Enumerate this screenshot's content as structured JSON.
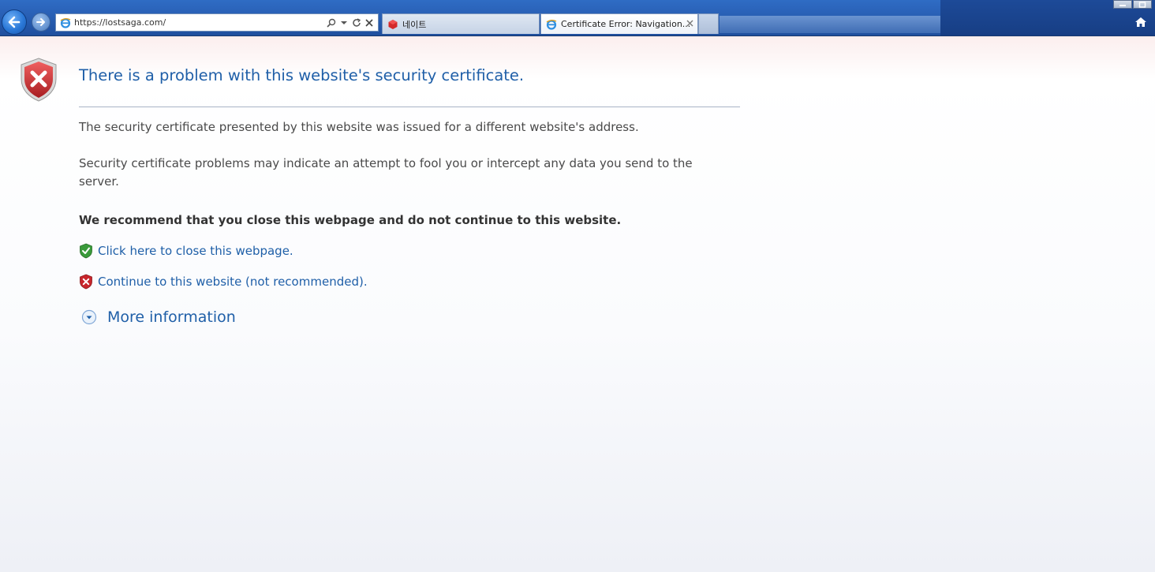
{
  "browser": {
    "address_url": "https://lostsaga.com/",
    "tabs": [
      {
        "label": "네이트",
        "active": false
      },
      {
        "label": "Certificate Error: Navigation...",
        "active": true
      }
    ]
  },
  "error_page": {
    "title": "There is a problem with this website's security certificate.",
    "paragraph1": "The security certificate presented by this website was issued for a different website's address.",
    "paragraph2": "Security certificate problems may indicate an attempt to fool you or intercept any data you send to the server.",
    "recommendation": "We recommend that you close this webpage and do not continue to this website.",
    "close_link": "Click here to close this webpage.",
    "continue_link": "Continue to this website (not recommended).",
    "more_info": "More information"
  },
  "colors": {
    "link": "#1f5fa8",
    "chrome": "#2a62b8",
    "error_shield": "#c8262c",
    "safe_shield": "#3a9a3a"
  }
}
